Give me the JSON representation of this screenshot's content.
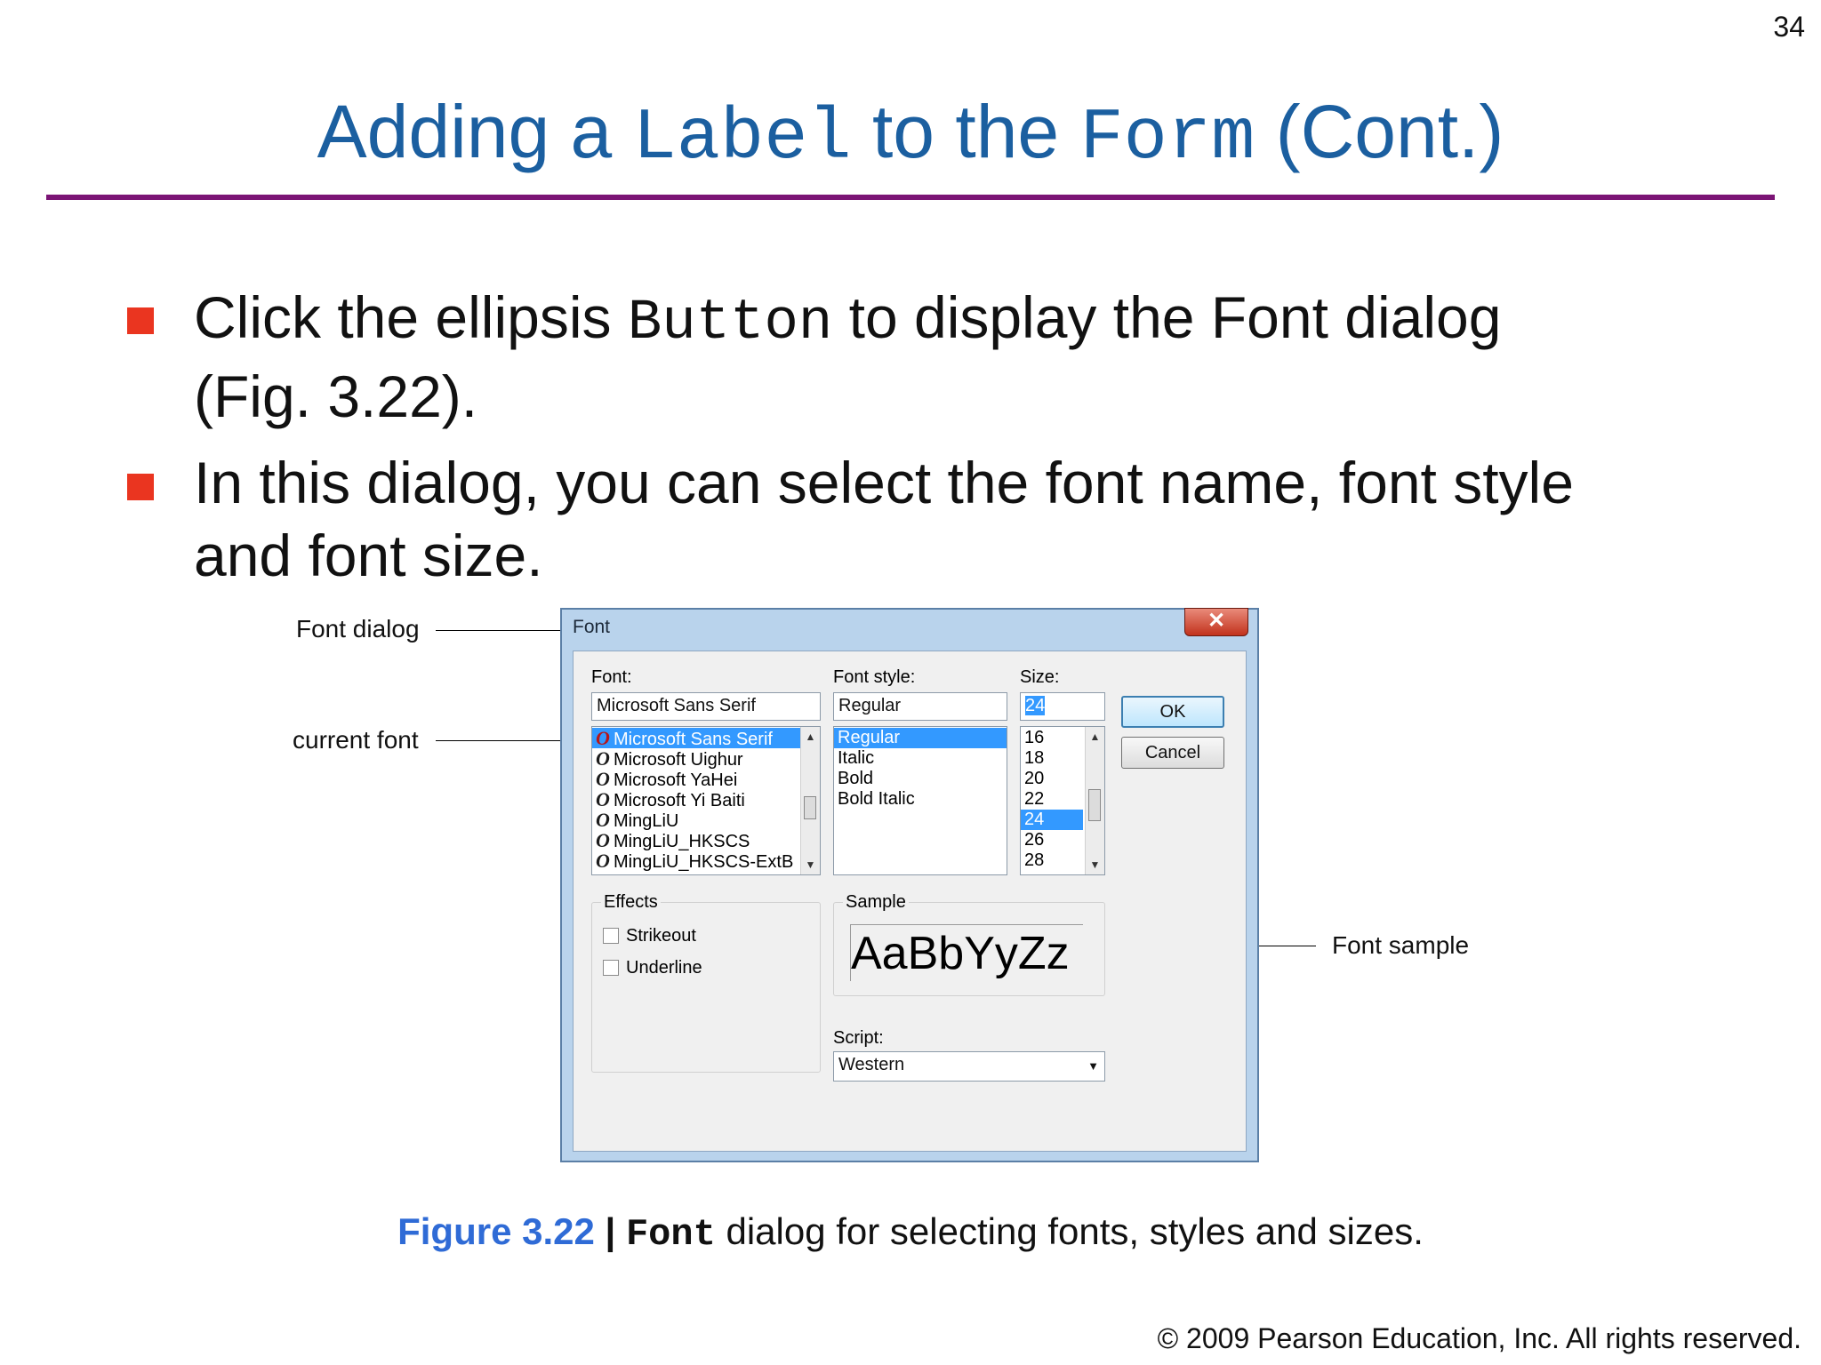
{
  "slide": {
    "page_number": "34",
    "title": {
      "part1": "Adding a ",
      "code1": "Label",
      "part2": " to the ",
      "code2": "Form",
      "part3": " (Cont.)"
    },
    "bullets": [
      {
        "line1a": "Click the ellipsis ",
        "line1code": "Button",
        "line1b": " to display the Font dialog",
        "line2": "(Fig. 3.22)."
      },
      {
        "line1": "In this dialog, you can select the font name, font style",
        "line2": "and font size."
      }
    ],
    "caption": {
      "figure": "Figure 3.22",
      "separator": " | ",
      "code": "Font",
      "rest": " dialog for selecting fonts, styles and sizes."
    },
    "copyright": "© 2009 Pearson Education, Inc.  All rights reserved."
  },
  "callouts": {
    "font_dialog": "Font dialog",
    "current_font": "current font",
    "font_sample": "Font sample"
  },
  "dialog": {
    "title": "Font",
    "close_glyph": "✕",
    "font": {
      "label": "Font:",
      "value": "Microsoft Sans Serif",
      "items": [
        "Microsoft Sans Serif",
        "Microsoft Uighur",
        "Microsoft YaHei",
        "Microsoft Yi Baiti",
        "MingLiU",
        "MingLiU_HKSCS",
        "MingLiU_HKSCS-ExtB"
      ],
      "selected": "Microsoft Sans Serif",
      "item_icon": "O"
    },
    "style": {
      "label": "Font style:",
      "value": "Regular",
      "items": [
        "Regular",
        "Italic",
        "Bold",
        "Bold Italic"
      ],
      "selected": "Regular"
    },
    "size": {
      "label": "Size:",
      "value": "24",
      "items": [
        "16",
        "18",
        "20",
        "22",
        "24",
        "26",
        "28"
      ],
      "selected": "24"
    },
    "ok_label": "OK",
    "cancel_label": "Cancel",
    "effects": {
      "title": "Effects",
      "strikeout": {
        "label": "Strikeout",
        "checked": false
      },
      "underline": {
        "label": "Underline",
        "checked": false
      }
    },
    "sample": {
      "title": "Sample",
      "text": "AaBbYyZz"
    },
    "script": {
      "label": "Script:",
      "value": "Western"
    },
    "scroll_up_glyph": "▲",
    "scroll_down_glyph": "▼",
    "dropdown_glyph": "▼"
  }
}
